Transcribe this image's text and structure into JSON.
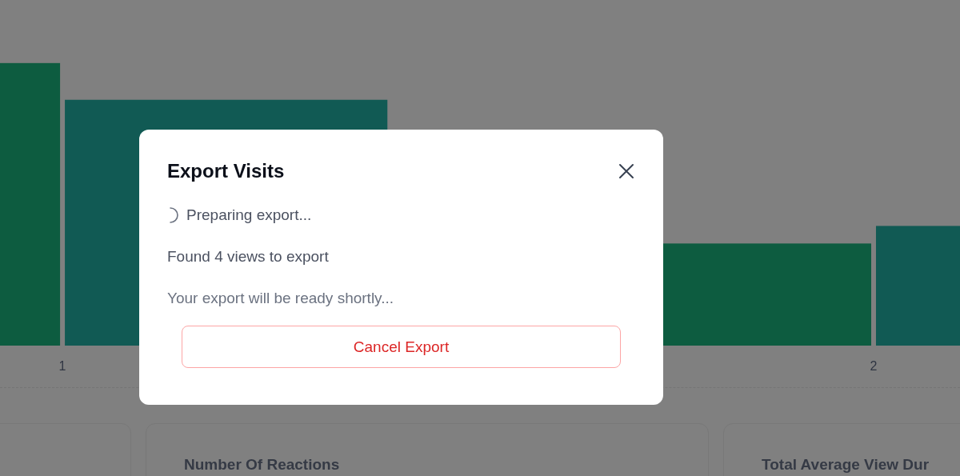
{
  "chart": {
    "x_labels": [
      "1",
      "2"
    ]
  },
  "cards": [
    {
      "title": "Number Of Reactions"
    },
    {
      "title": "Total Average View Dur"
    }
  ],
  "modal": {
    "title": "Export Visits",
    "status": {
      "text": "Preparing export...",
      "loading": true
    },
    "message": "Found 4 views to export",
    "note": "Your export will be ready shortly...",
    "cancel_button": "Cancel Export"
  }
}
